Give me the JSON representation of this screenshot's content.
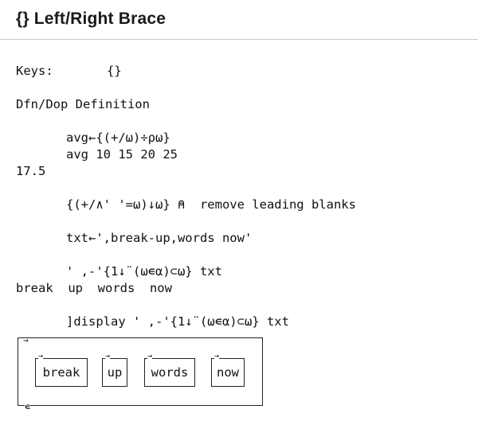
{
  "header": {
    "title": "{} Left/Right Brace"
  },
  "lines": {
    "keys_label": "Keys:",
    "keys_value": "{}",
    "section": "Dfn/Dop Definition",
    "l1": "avg←{(+/⍵)÷⍴⍵}",
    "l2": "avg 10 15 20 25",
    "l3": "17.5",
    "l4": "{(+/∧' '=⍵)↓⍵} ⍝  remove leading blanks",
    "l5": "txt←',break-up,words now'",
    "l6": "' ,-'{1↓¨(⍵∊⍺)⊂⍵} txt",
    "l7": "break  up  words  now",
    "l8": "]display ' ,-'{1↓¨(⍵∊⍺)⊂⍵} txt"
  },
  "display": {
    "cells": [
      "break",
      "up",
      "words",
      "now"
    ],
    "arrow": "→",
    "epsilon": "∊"
  }
}
